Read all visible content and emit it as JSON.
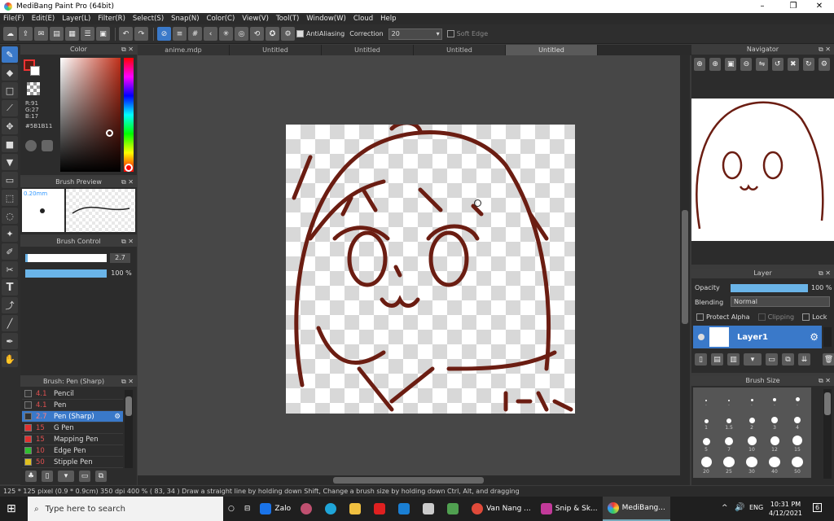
{
  "window": {
    "title": "MediBang Paint Pro (64bit)",
    "min": "–",
    "max": "❐",
    "close": "✕"
  },
  "menu": [
    "File(F)",
    "Edit(E)",
    "Layer(L)",
    "Filter(R)",
    "Select(S)",
    "Snap(N)",
    "Color(C)",
    "View(V)",
    "Tool(T)",
    "Window(W)",
    "Cloud",
    "Help"
  ],
  "toolbar": {
    "antialiasing": "AntiAliasing",
    "correction_label": "Correction",
    "correction_value": "20",
    "soft_edge": "Soft Edge"
  },
  "tabs": [
    "anime.mdp",
    "Untitled",
    "Untitled",
    "Untitled",
    "Untitled"
  ],
  "color_panel": {
    "title": "Color",
    "r": "R:91",
    "g": "G:27",
    "b": "B:17",
    "hex": "#5B1B11",
    "main_color": "#5b1b11"
  },
  "brush_preview": {
    "title": "Brush Preview",
    "size": "0.20mm"
  },
  "brush_control": {
    "title": "Brush Control",
    "size": "2.7",
    "opacity": "100 %",
    "size_fraction": 0.03,
    "opacity_fraction": 1.0
  },
  "brush_list": {
    "title": "Brush: Pen (Sharp)",
    "items": [
      {
        "size": "4.1",
        "name": "Pencil",
        "color": "#333333"
      },
      {
        "size": "4.1",
        "name": "Pen",
        "color": "#333333"
      },
      {
        "size": "2.7",
        "name": "Pen (Sharp)",
        "color": "#333333",
        "active": true
      },
      {
        "size": "15",
        "name": "G Pen",
        "color": "#e03030"
      },
      {
        "size": "15",
        "name": "Mapping Pen",
        "color": "#e03030"
      },
      {
        "size": "10",
        "name": "Edge Pen",
        "color": "#30c030"
      },
      {
        "size": "50",
        "name": "Stipple Pen",
        "color": "#e0c020"
      }
    ]
  },
  "navigator": {
    "title": "Navigator"
  },
  "layer_panel": {
    "title": "Layer",
    "opacity_label": "Opacity",
    "opacity_value": "100 %",
    "opacity_fraction": 1.0,
    "blending_label": "Blending",
    "blending_value": "Normal",
    "protect_alpha": "Protect Alpha",
    "clipping": "Clipping",
    "lock": "Lock",
    "layer_name": "Layer1"
  },
  "brush_size_panel": {
    "title": "Brush Size",
    "sizes": [
      "·",
      "·",
      "·",
      "·",
      "·",
      "1",
      "1.5",
      "2",
      "3",
      "4",
      "5",
      "7",
      "10",
      "12",
      "15",
      "20",
      "25",
      "30",
      "40",
      "50"
    ]
  },
  "status": {
    "text": "125 * 125 pixel  (0.9 * 0.9cm)  350 dpi  400 %  ( 83, 34 )  Draw a straight line by holding down Shift, Change a brush size by holding down Ctrl, Alt, and dragging"
  },
  "taskbar": {
    "search": "Type here to search",
    "apps": [
      "Zalo",
      "Van Nang ...",
      "Snip & Sk...",
      "MediBang..."
    ],
    "lang": "ENG",
    "time": "10:31 PM",
    "date": "4/12/2021",
    "notif": "6"
  }
}
